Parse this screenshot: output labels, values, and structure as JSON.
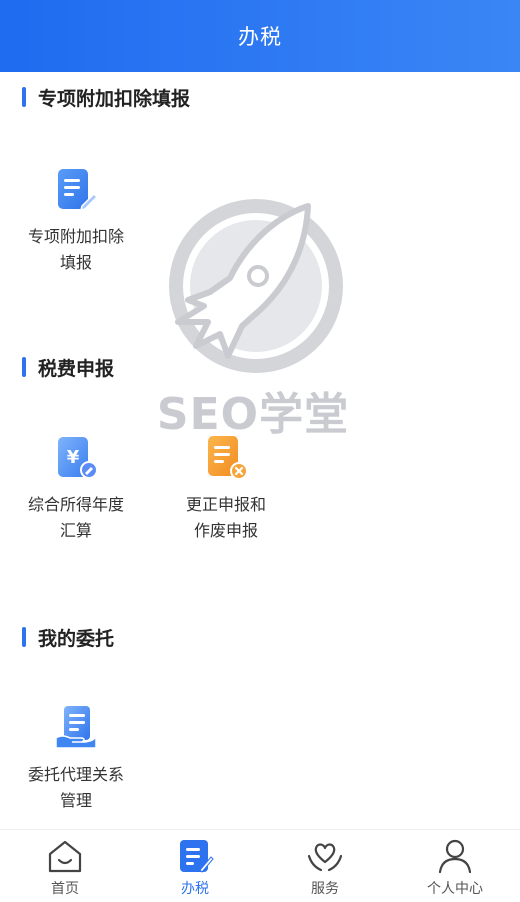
{
  "header": {
    "title": "办税"
  },
  "sections": [
    {
      "title": "专项附加扣除填报",
      "items": [
        {
          "label_line1": "专项附加扣除",
          "label_line2": "填报",
          "icon": "form-edit-icon"
        }
      ]
    },
    {
      "title": "税费申报",
      "items": [
        {
          "label_line1": "综合所得年度",
          "label_line2": "汇算",
          "icon": "yuan-document-icon"
        },
        {
          "label_line1": "更正申报和",
          "label_line2": "作废申报",
          "icon": "document-cancel-icon"
        }
      ]
    },
    {
      "title": "我的委托",
      "items": [
        {
          "label_line1": "委托代理关系",
          "label_line2": "管理",
          "icon": "document-hand-icon"
        }
      ]
    }
  ],
  "watermark": {
    "text": "SEO学堂",
    "icon": "rocket-logo"
  },
  "tabbar": {
    "active": "办税",
    "tabs": [
      {
        "label": "首页",
        "icon": "home-icon"
      },
      {
        "label": "办税",
        "icon": "tax-edit-icon"
      },
      {
        "label": "服务",
        "icon": "heart-hands-icon"
      },
      {
        "label": "个人中心",
        "icon": "user-icon"
      }
    ]
  },
  "colors": {
    "primary": "#2d73f0",
    "header_start": "#1f6bf0",
    "header_end": "#3b86f5",
    "orange": "#f7a53a"
  }
}
